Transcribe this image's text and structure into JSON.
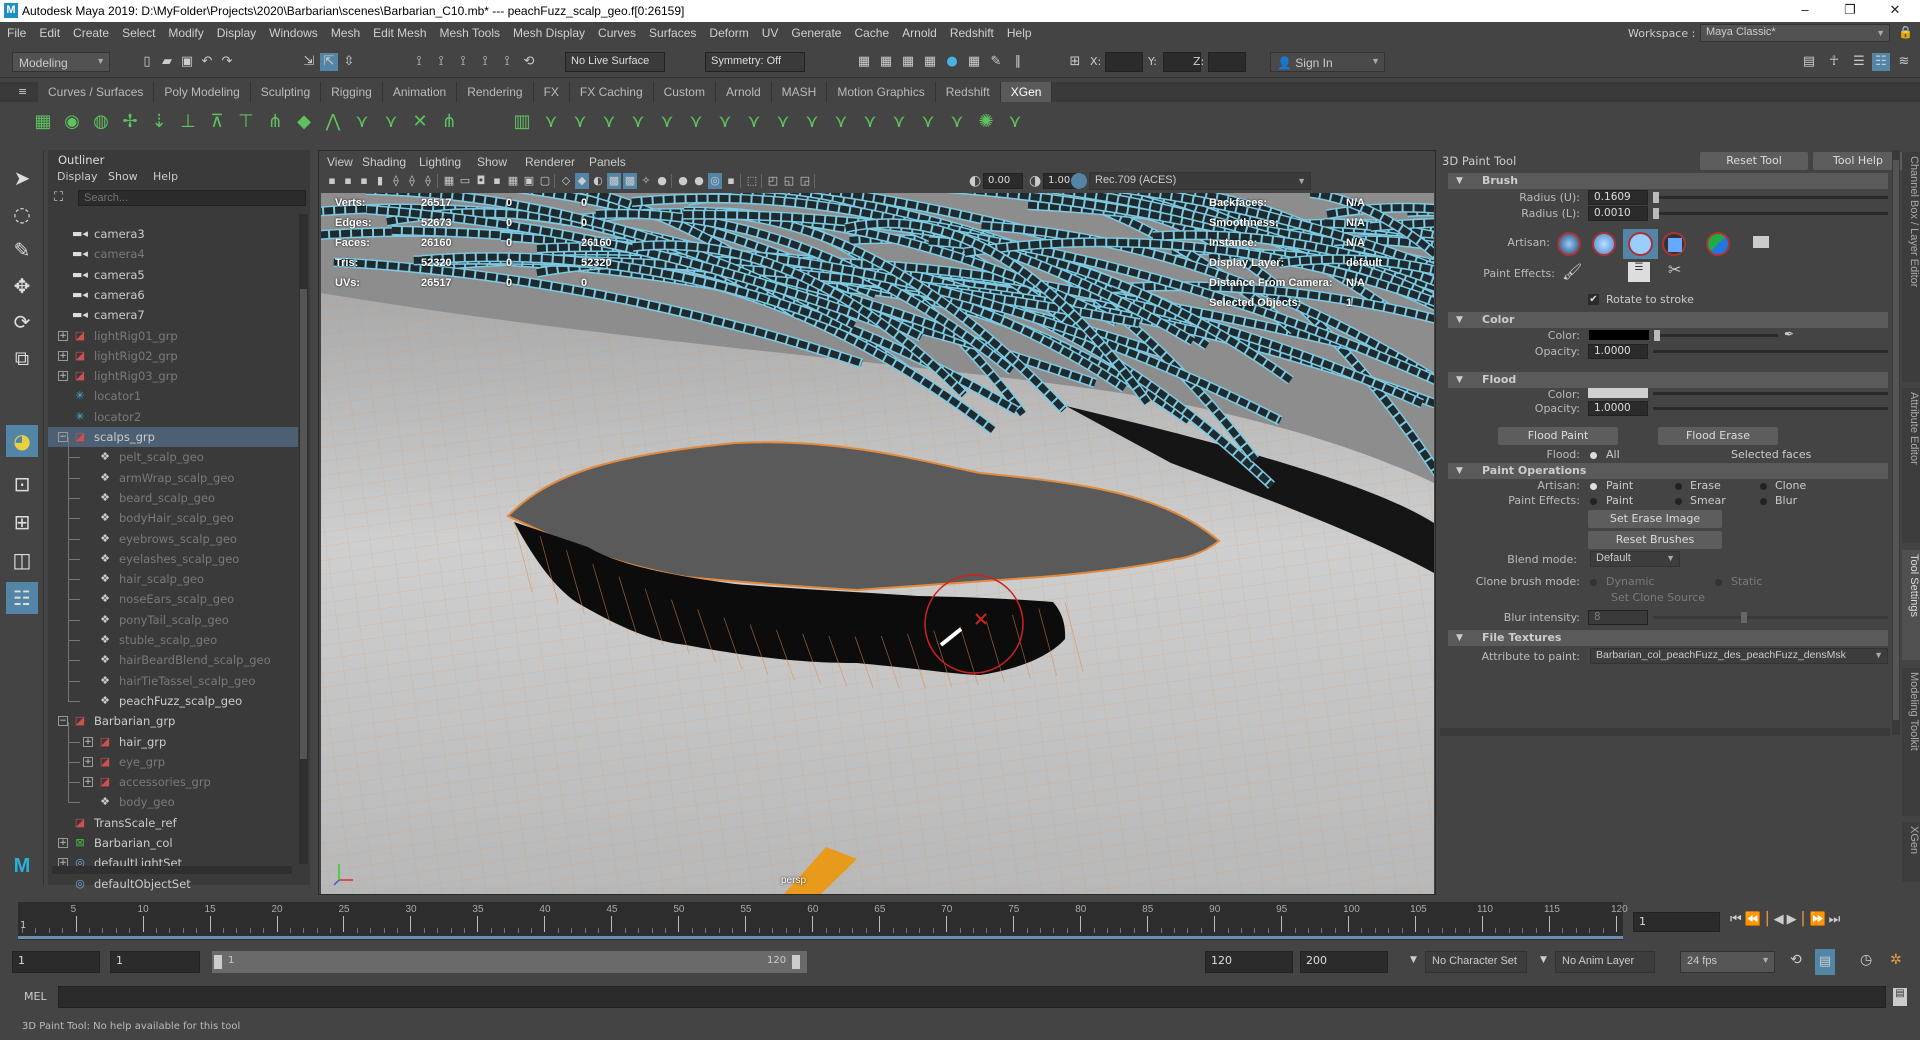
{
  "titlebar": {
    "title": "Autodesk Maya 2019: D:\\MyFolder\\Projects\\2020\\Barbarian\\scenes\\Barbarian_C10.mb*  ---  peachFuzz_scalp_geo.f[0:26159]",
    "logo": "M",
    "minimize": "–",
    "maximize": "❐",
    "close": "✕"
  },
  "menubar": {
    "items": [
      "File",
      "Edit",
      "Create",
      "Select",
      "Modify",
      "Display",
      "Windows",
      "Mesh",
      "Edit Mesh",
      "Mesh Tools",
      "Mesh Display",
      "Curves",
      "Surfaces",
      "Deform",
      "UV",
      "Generate",
      "Cache",
      "Arnold",
      "Redshift",
      "Help"
    ],
    "workspace_label": "Workspace :",
    "workspace_value": "Maya Classic*"
  },
  "statusline": {
    "menuset": "Modeling",
    "live_surface": "No Live Surface",
    "symmetry": "Symmetry: Off",
    "x_label": "X:",
    "y_label": "Y:",
    "z_label": "Z:",
    "sign_in": "Sign In"
  },
  "shelf": {
    "tabs": [
      "Curves / Surfaces",
      "Poly Modeling",
      "Sculpting",
      "Rigging",
      "Animation",
      "Rendering",
      "FX",
      "FX Caching",
      "Custom",
      "Arnold",
      "MASH",
      "Motion Graphics",
      "Redshift",
      "XGen"
    ],
    "active_tab": "XGen"
  },
  "outliner": {
    "title": "Outliner",
    "menus": [
      "Display",
      "Show",
      "Help"
    ],
    "search_placeholder": "Search...",
    "items": [
      {
        "name": "camera3",
        "type": "camera",
        "level": 0,
        "dim": false
      },
      {
        "name": "camera4",
        "type": "camera",
        "level": 0,
        "dim": true
      },
      {
        "name": "camera5",
        "type": "camera",
        "level": 0,
        "dim": false
      },
      {
        "name": "camera6",
        "type": "camera",
        "level": 0,
        "dim": false
      },
      {
        "name": "camera7",
        "type": "camera",
        "level": 0,
        "dim": false
      },
      {
        "name": "lightRig01_grp",
        "type": "group",
        "level": 0,
        "dim": true,
        "expander": "+"
      },
      {
        "name": "lightRig02_grp",
        "type": "group",
        "level": 0,
        "dim": true,
        "expander": "+"
      },
      {
        "name": "lightRig03_grp",
        "type": "group",
        "level": 0,
        "dim": true,
        "expander": "+"
      },
      {
        "name": "locator1",
        "type": "locator",
        "level": 0,
        "dim": true
      },
      {
        "name": "locator2",
        "type": "locator",
        "level": 0,
        "dim": true
      },
      {
        "name": "scalps_grp",
        "type": "group",
        "level": 0,
        "dim": false,
        "expander": "-",
        "selected": true
      },
      {
        "name": "pelt_scalp_geo",
        "type": "mesh",
        "level": 1,
        "dim": true
      },
      {
        "name": "armWrap_scalp_geo",
        "type": "mesh",
        "level": 1,
        "dim": true
      },
      {
        "name": "beard_scalp_geo",
        "type": "mesh",
        "level": 1,
        "dim": true
      },
      {
        "name": "bodyHair_scalp_geo",
        "type": "mesh",
        "level": 1,
        "dim": true
      },
      {
        "name": "eyebrows_scalp_geo",
        "type": "mesh",
        "level": 1,
        "dim": true
      },
      {
        "name": "eyelashes_scalp_geo",
        "type": "mesh",
        "level": 1,
        "dim": true
      },
      {
        "name": "hair_scalp_geo",
        "type": "mesh",
        "level": 1,
        "dim": true
      },
      {
        "name": "noseEars_scalp_geo",
        "type": "mesh",
        "level": 1,
        "dim": true
      },
      {
        "name": "ponyTail_scalp_geo",
        "type": "mesh",
        "level": 1,
        "dim": true
      },
      {
        "name": "stuble_scalp_geo",
        "type": "mesh",
        "level": 1,
        "dim": true
      },
      {
        "name": "hairBeardBlend_scalp_geo",
        "type": "mesh",
        "level": 1,
        "dim": true
      },
      {
        "name": "hairTieTassel_scalp_geo",
        "type": "mesh",
        "level": 1,
        "dim": true
      },
      {
        "name": "peachFuzz_scalp_geo",
        "type": "mesh",
        "level": 1,
        "dim": false
      },
      {
        "name": "Barbarian_grp",
        "type": "group",
        "level": 0,
        "dim": false,
        "expander": "-"
      },
      {
        "name": "hair_grp",
        "type": "group",
        "level": 1,
        "dim": false,
        "expander": "+"
      },
      {
        "name": "eye_grp",
        "type": "group",
        "level": 1,
        "dim": true,
        "expander": "+"
      },
      {
        "name": "accessories_grp",
        "type": "group",
        "level": 1,
        "dim": true,
        "expander": "+"
      },
      {
        "name": "body_geo",
        "type": "mesh",
        "level": 1,
        "dim": true
      },
      {
        "name": "TransScale_ref",
        "type": "group",
        "level": 0,
        "dim": false
      },
      {
        "name": "Barbarian_col",
        "type": "collection",
        "level": 0,
        "dim": false,
        "expander": "+"
      },
      {
        "name": "defaultLightSet",
        "type": "set",
        "level": 0,
        "dim": false,
        "expander": "+"
      },
      {
        "name": "defaultObjectSet",
        "type": "set",
        "level": 0,
        "dim": false
      }
    ]
  },
  "viewport": {
    "menus": [
      "View",
      "Shading",
      "Lighting",
      "Show",
      "Renderer",
      "Panels"
    ],
    "exposure": "0.00",
    "gamma": "1.00",
    "color_space": "Rec.709 (ACES)",
    "camera": "persp",
    "hud_left": [
      [
        "Verts:",
        "26517",
        "0",
        "0"
      ],
      [
        "Edges:",
        "52673",
        "0",
        "0"
      ],
      [
        "Faces:",
        "26160",
        "0",
        "26160"
      ],
      [
        "Tris:",
        "52320",
        "0",
        "52320"
      ],
      [
        "UVs:",
        "26517",
        "0",
        "0"
      ]
    ],
    "hud_right": [
      [
        "Backfaces:",
        "N/A"
      ],
      [
        "Smoothness:",
        "N/A"
      ],
      [
        "Instance:",
        "N/A"
      ],
      [
        "Display Layer:",
        "default"
      ],
      [
        "Distance From Camera:",
        "N/A"
      ],
      [
        "Selected Objects:",
        "1"
      ]
    ]
  },
  "tool": {
    "title": "3D Paint Tool",
    "reset": "Reset Tool",
    "help": "Tool Help",
    "brush": {
      "header": "Brush",
      "radius_u_label": "Radius (U):",
      "radius_u": "0.1609",
      "radius_l_label": "Radius (L):",
      "radius_l": "0.0010",
      "artisan_label": "Artisan:",
      "paint_effects_label": "Paint Effects:",
      "rotate_label": "Rotate to stroke",
      "rotate_checked": true
    },
    "color": {
      "header": "Color",
      "color_label": "Color:",
      "color_value": "#000000",
      "opacity_label": "Opacity:",
      "opacity": "1.0000"
    },
    "flood": {
      "header": "Flood",
      "color_label": "Color:",
      "color_value": "#d0d0d0",
      "opacity_label": "Opacity:",
      "opacity": "1.0000",
      "flood_paint": "Flood Paint",
      "flood_erase": "Flood Erase",
      "flood_label": "Flood:",
      "all": "All",
      "selected_faces": "Selected faces"
    },
    "ops": {
      "header": "Paint Operations",
      "artisan_label": "Artisan:",
      "artisan_opts": [
        "Paint",
        "Erase",
        "Clone"
      ],
      "pe_label": "Paint Effects:",
      "pe_opts": [
        "Paint",
        "Smear",
        "Blur"
      ],
      "set_erase": "Set Erase Image",
      "reset_brushes": "Reset Brushes",
      "blend_label": "Blend mode:",
      "blend_value": "Default",
      "clone_label": "Clone brush mode:",
      "clone_opts": [
        "Dynamic",
        "Static"
      ],
      "set_clone": "Set Clone Source",
      "blur_label": "Blur intensity:",
      "blur_value": "8"
    },
    "textures": {
      "header": "File Textures",
      "attr_label": "Attribute to paint:",
      "attr_value": "Barbarian_col_peachFuzz_des_peachFuzz_densMsk"
    }
  },
  "side_tabs": [
    "Channel Box / Layer Editor",
    "Attribute Editor",
    "Tool Settings",
    "Modeling Toolkit",
    "XGen"
  ],
  "timeline": {
    "start": 1,
    "end": 120,
    "labels": [
      5,
      10,
      15,
      20,
      25,
      30,
      35,
      40,
      45,
      50,
      55,
      60,
      65,
      70,
      75,
      80,
      85,
      90,
      95,
      100,
      105,
      110,
      115,
      120
    ],
    "current_frame": "1",
    "first_label": "1"
  },
  "range": {
    "start": "1",
    "playback_start": "1",
    "slider_start": "1",
    "slider_end": "120",
    "playback_end": "120",
    "end": "200",
    "character_set": "No Character Set",
    "anim_layer": "No Anim Layer",
    "fps": "24 fps"
  },
  "mel": {
    "label": "MEL"
  },
  "helpline": {
    "text": "3D Paint Tool: No help available for this tool"
  },
  "colors": {
    "accent": "#5285a6",
    "selection": "#4d5f73",
    "brush_cursor": "#d02020",
    "wire": "#e08a40",
    "hair_wire": "#7ec8e0"
  }
}
